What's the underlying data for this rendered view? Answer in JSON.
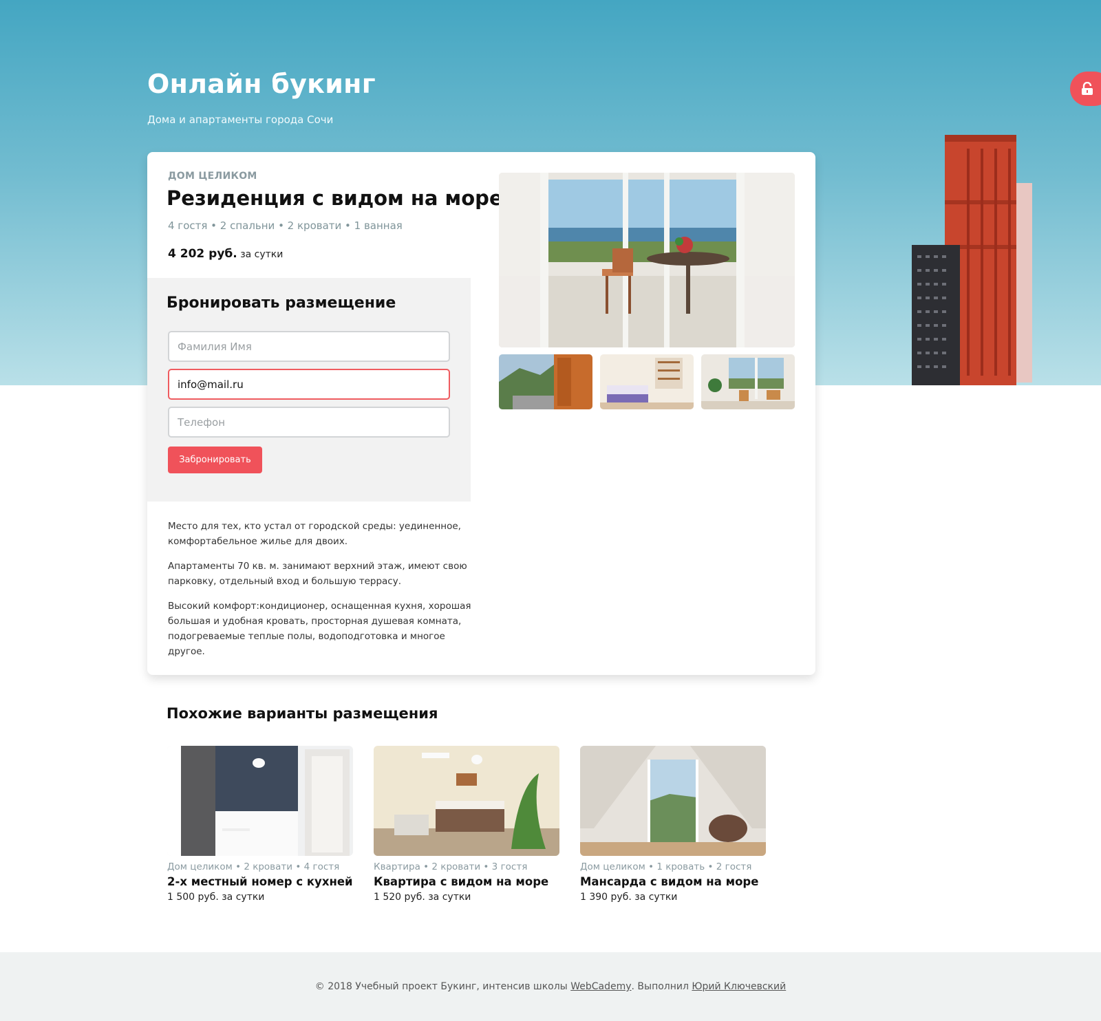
{
  "site": {
    "title": "Онлайн букинг",
    "subtitle": "Дома и апартаменты города Сочи"
  },
  "listing": {
    "type": "ДОМ ЦЕЛИКОМ",
    "title": "Резиденция с видом на море",
    "features": "4 гостя • 2 спальни • 2 кровати • 1 ванная",
    "price": "4 202 руб.",
    "price_suffix": "за сутки"
  },
  "booking": {
    "title": "Бронировать размещение",
    "name_placeholder": "Фамилия Имя",
    "email_value": "info@mail.ru",
    "phone_placeholder": "Телефон",
    "submit_label": "Забронировать"
  },
  "description": [
    "Место для тех, кто устал от городской среды: уединенное, комфортабельное жилье для двоих.",
    "Апартаменты 70 кв. м. занимают верхний этаж, имеют свою парковку, отдельный вход и большую террасу.",
    "Высокий комфорт:кондиционер, оснащенная кухня, хорошая большая и удобная кровать, просторная душевая комната, подогреваемые теплые полы, водоподготовка и многое другое."
  ],
  "similar": {
    "title": "Похожие варианты размещения",
    "offers": [
      {
        "meta": "Дом целиком • 2 кровати • 4 гостя",
        "name": "2-х местный номер с кухней",
        "price": "1 500 руб. за сутки"
      },
      {
        "meta": "Квартира • 2 кровати • 3 гостя",
        "name": "Квартира с видом на море",
        "price": "1 520 руб. за сутки"
      },
      {
        "meta": "Дом целиком • 1 кровать • 2 гостя",
        "name": "Мансарда с видом на море",
        "price": "1 390 руб. за сутки"
      }
    ]
  },
  "footer": {
    "prefix": "© 2018 Учебный проект Букинг, интенсив школы",
    "school_link": "WebCademy",
    "middle": ". Выполнил",
    "author_link": "Юрий Ключевский"
  },
  "icons": {
    "lock": "lock-open-icon"
  },
  "colors": {
    "accent": "#f0525a",
    "muted": "#8a9aa0",
    "hero_top": "#44a6c2",
    "hero_bottom": "#b9e0e8",
    "footer_bg": "#eff2f2"
  }
}
